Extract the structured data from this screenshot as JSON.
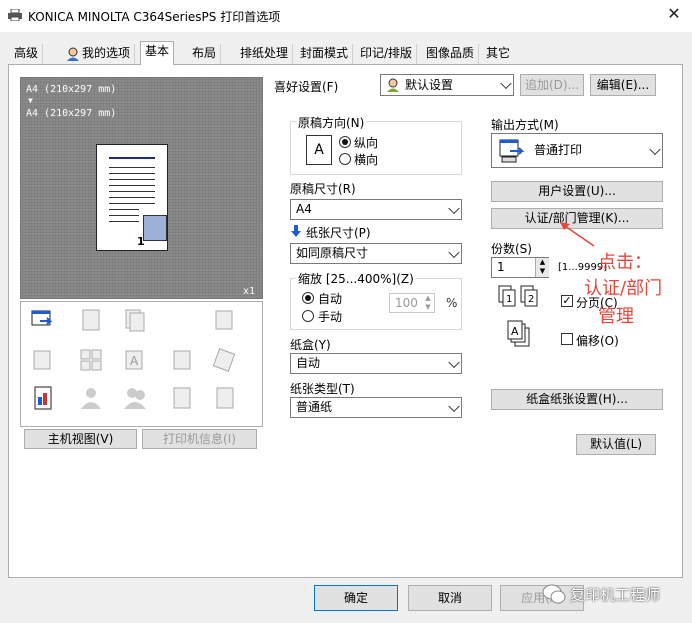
{
  "window": {
    "title": "KONICA MINOLTA C364SeriesPS 打印首选项"
  },
  "tabs": [
    {
      "label": "高级"
    },
    {
      "label": "我的选项"
    },
    {
      "label": "基本"
    },
    {
      "label": "布局"
    },
    {
      "label": "排纸处理"
    },
    {
      "label": "封面模式"
    },
    {
      "label": "印记/排版"
    },
    {
      "label": "图像品质"
    },
    {
      "label": "其它"
    }
  ],
  "preview": {
    "line1": "A4 (210x297 mm)",
    "arrow": "▼",
    "line2": "A4 (210x297 mm)",
    "count": "x1",
    "page_number": "1"
  },
  "left_buttons": {
    "host_view": "主机视图(V)",
    "printer_info": "打印机信息(I)"
  },
  "favorites": {
    "label": "喜好设置(F)",
    "value": "默认设置",
    "add": "追加(D)...",
    "edit": "编辑(E)..."
  },
  "orientation": {
    "label": "原稿方向(N)",
    "portrait": "纵向",
    "landscape": "横向",
    "selected": "portrait",
    "icon_text": "A"
  },
  "original_size": {
    "label": "原稿尺寸(R)",
    "value": "A4"
  },
  "paper_size": {
    "label": "纸张尺寸(P)",
    "value": "如同原稿尺寸"
  },
  "zoom": {
    "label": "缩放 [25...400%](Z)",
    "auto": "自动",
    "manual": "手动",
    "value": "100",
    "unit": "%",
    "selected": "auto"
  },
  "tray": {
    "label": "纸盒(Y)",
    "value": "自动"
  },
  "paper_type": {
    "label": "纸张类型(T)",
    "value": "普通纸"
  },
  "output": {
    "label": "输出方式(M)",
    "value": "普通打印"
  },
  "user_settings": "用户设置(U)...",
  "auth_button": "认证/部门管理(K)...",
  "copies": {
    "label": "份数(S)",
    "value": "1",
    "range": "[1...9999]"
  },
  "collate": {
    "label": "分页(C)",
    "checked": true
  },
  "offset": {
    "label": "偏移(O)",
    "checked": false
  },
  "tray_settings": "纸盒纸张设置(H)...",
  "defaults": "默认值(L)",
  "dialog": {
    "ok": "确定",
    "cancel": "取消",
    "apply": "应用(A)"
  },
  "annotation": {
    "line1": "点击：",
    "line2": "认证/部门",
    "line3": "管理"
  },
  "watermark": "复印机工程师",
  "colors": {
    "accent_blue": "#1e5bd6",
    "annotation_red": "#e8463a"
  }
}
